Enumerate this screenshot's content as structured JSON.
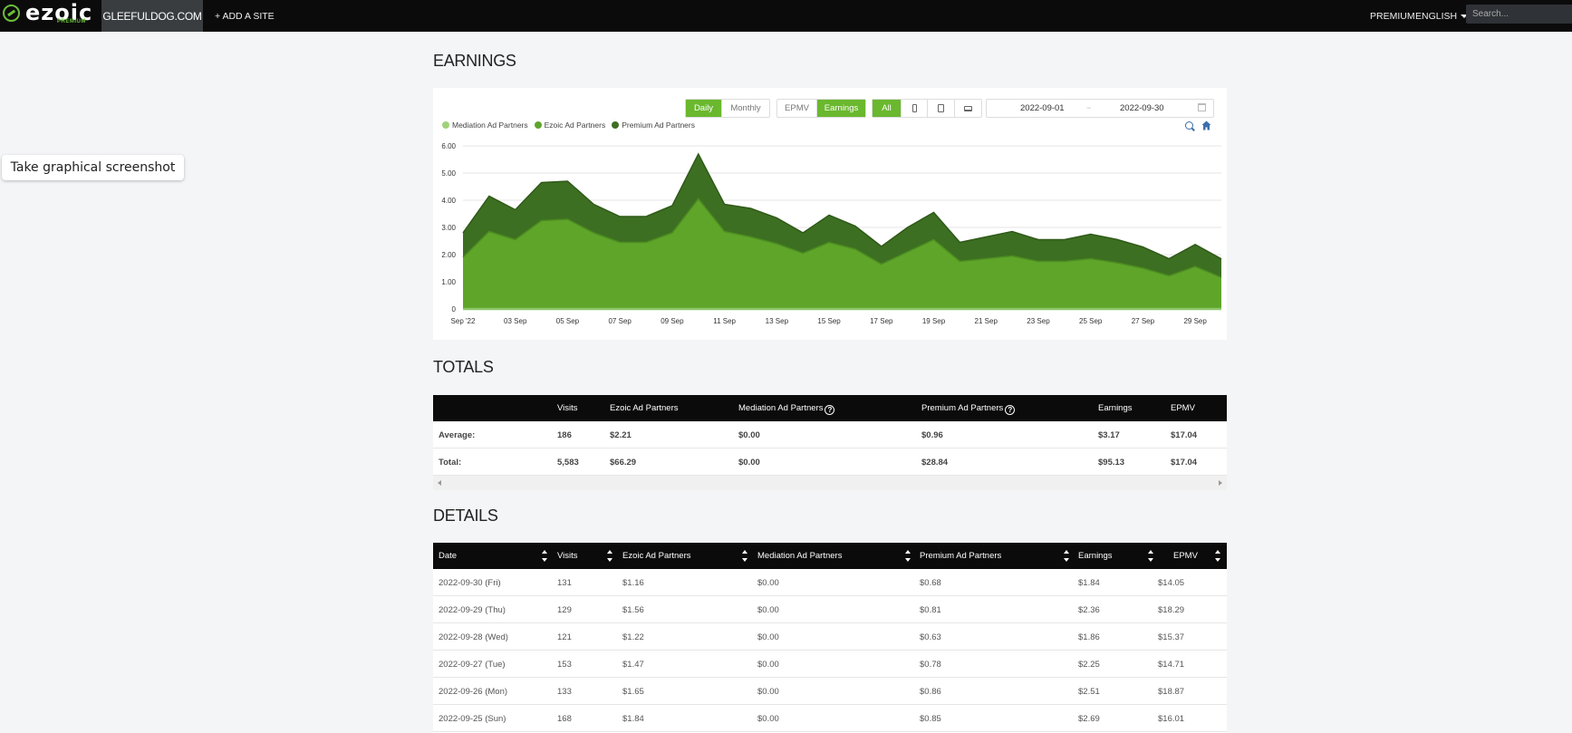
{
  "nav": {
    "logo_text": "ezoic",
    "logo_sub": "PREMIUM",
    "site": "GLEEFULDOG.COM",
    "add_site": "+ ADD A SITE",
    "premium": "PREMIUM",
    "language": "ENGLISH",
    "search_placeholder": "Search..."
  },
  "screenshot_button": "Take graphical screenshot",
  "earnings": {
    "title": "EARNINGS",
    "period_buttons": [
      "Daily",
      "Monthly"
    ],
    "period_active": "Daily",
    "metric_buttons": [
      "EPMV",
      "Earnings"
    ],
    "metric_active": "Earnings",
    "device_all": "All",
    "date_from": "2022-09-01",
    "date_sep": "~",
    "date_to": "2022-09-30",
    "colors": {
      "mediation": "#9fd27b",
      "ezoic": "#5ea52a",
      "premium": "#3d6f22",
      "active_button": "#6ab82e"
    }
  },
  "chart_data": {
    "type": "area",
    "stacked": true,
    "x_tick_labels": [
      "Sep '22",
      "03 Sep",
      "05 Sep",
      "07 Sep",
      "09 Sep",
      "11 Sep",
      "13 Sep",
      "15 Sep",
      "17 Sep",
      "19 Sep",
      "21 Sep",
      "23 Sep",
      "25 Sep",
      "27 Sep",
      "29 Sep"
    ],
    "y_tick_labels": [
      "0",
      "1.00",
      "2.00",
      "3.00",
      "4.00",
      "5.00",
      "6.00"
    ],
    "ylim": [
      0,
      6
    ],
    "legend": [
      "Mediation Ad Partners",
      "Ezoic Ad Partners",
      "Premium Ad Partners"
    ],
    "legend_placement": "top-left",
    "grid": true,
    "days": [
      1,
      2,
      3,
      4,
      5,
      6,
      7,
      8,
      9,
      10,
      11,
      12,
      13,
      14,
      15,
      16,
      17,
      18,
      19,
      20,
      21,
      22,
      23,
      24,
      25,
      26,
      27,
      28,
      29,
      30
    ],
    "series": [
      {
        "name": "Mediation Ad Partners",
        "values": [
          0,
          0,
          0,
          0,
          0,
          0,
          0,
          0,
          0,
          0,
          0,
          0,
          0,
          0,
          0,
          0,
          0,
          0,
          0,
          0,
          0,
          0,
          0,
          0,
          0,
          0,
          0,
          0,
          0,
          0
        ]
      },
      {
        "name": "Ezoic Ad Partners",
        "values": [
          1.9,
          2.85,
          2.55,
          3.25,
          3.3,
          2.8,
          2.45,
          2.45,
          2.8,
          4.05,
          2.85,
          2.65,
          2.4,
          2.05,
          2.45,
          2.2,
          1.65,
          2.1,
          2.55,
          1.75,
          1.85,
          1.95,
          1.75,
          1.75,
          1.85,
          1.7,
          1.5,
          1.22,
          1.56,
          1.16
        ]
      },
      {
        "name": "Premium Ad Partners",
        "values": [
          0.9,
          1.3,
          1.1,
          1.4,
          1.4,
          1.05,
          0.95,
          0.95,
          1.0,
          1.65,
          1.0,
          1.05,
          0.95,
          0.75,
          1.0,
          0.85,
          0.65,
          0.9,
          1.0,
          0.7,
          0.8,
          0.9,
          0.8,
          0.8,
          0.9,
          0.86,
          0.78,
          0.63,
          0.81,
          0.68
        ]
      }
    ]
  },
  "totals": {
    "title": "TOTALS",
    "columns": [
      "",
      "Visits",
      "Ezoic Ad Partners",
      "Mediation Ad Partners",
      "Premium Ad Partners",
      "Earnings",
      "EPMV"
    ],
    "rows": [
      [
        "Average:",
        "186",
        "$2.21",
        "$0.00",
        "$0.96",
        "$3.17",
        "$17.04"
      ],
      [
        "Total:",
        "5,583",
        "$66.29",
        "$0.00",
        "$28.84",
        "$95.13",
        "$17.04"
      ]
    ]
  },
  "details": {
    "title": "DETAILS",
    "columns": [
      "Date",
      "Visits",
      "Ezoic Ad Partners",
      "Mediation Ad Partners",
      "Premium Ad Partners",
      "Earnings",
      "EPMV"
    ],
    "rows": [
      [
        "2022-09-30 (Fri)",
        "131",
        "$1.16",
        "$0.00",
        "$0.68",
        "$1.84",
        "$14.05"
      ],
      [
        "2022-09-29 (Thu)",
        "129",
        "$1.56",
        "$0.00",
        "$0.81",
        "$2.36",
        "$18.29"
      ],
      [
        "2022-09-28 (Wed)",
        "121",
        "$1.22",
        "$0.00",
        "$0.63",
        "$1.86",
        "$15.37"
      ],
      [
        "2022-09-27 (Tue)",
        "153",
        "$1.47",
        "$0.00",
        "$0.78",
        "$2.25",
        "$14.71"
      ],
      [
        "2022-09-26 (Mon)",
        "133",
        "$1.65",
        "$0.00",
        "$0.86",
        "$2.51",
        "$18.87"
      ],
      [
        "2022-09-25 (Sun)",
        "168",
        "$1.84",
        "$0.00",
        "$0.85",
        "$2.69",
        "$16.01"
      ]
    ]
  }
}
